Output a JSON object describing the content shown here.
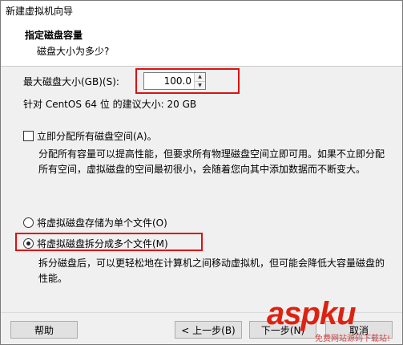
{
  "window": {
    "title": "新建虚拟机向导"
  },
  "header": {
    "title": "指定磁盘容量",
    "subtitle": "磁盘大小为多少?"
  },
  "disk": {
    "max_size_label": "最大磁盘大小(GB)(S):",
    "max_size_value": "100.0",
    "recommended": "针对 CentOS 64 位 的建议大小: 20 GB"
  },
  "allocate": {
    "checkbox_label": "立即分配所有磁盘空间(A)。",
    "checked": false,
    "description": "分配所有容量可以提高性能，但要求所有物理磁盘空间立即可用。如果不立即分配所有空间，虚拟磁盘的空间最初很小，会随着您向其中添加数据而不断变大。"
  },
  "storage": {
    "single_file_label": "将虚拟磁盘存储为单个文件(O)",
    "multi_file_label": "将虚拟磁盘拆分成多个文件(M)",
    "selected": "multi",
    "multi_description": "拆分磁盘后，可以更轻松地在计算机之间移动虚拟机，但可能会降低大容量磁盘的性能。"
  },
  "buttons": {
    "help": "帮助",
    "back": "< 上一步(B)",
    "next": "下一步(N)",
    "cancel": "取消"
  },
  "watermark": {
    "logo": "aspku",
    "sub": "免费网站源码下载站!"
  },
  "colors": {
    "highlight_box": "#dd1111",
    "window_bg": "#f0f0f0"
  }
}
